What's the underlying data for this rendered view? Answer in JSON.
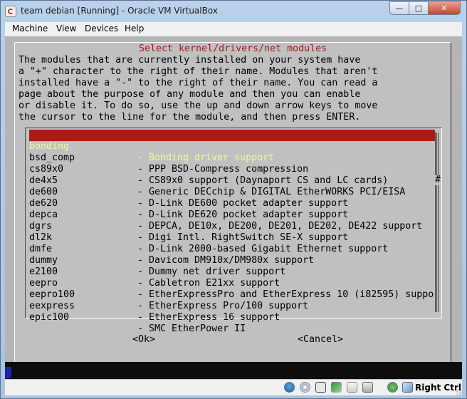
{
  "window": {
    "title": "team debian [Running] - Oracle VM VirtualBox",
    "controls": {
      "minimize": "—",
      "maximize": "□",
      "close": "✕"
    }
  },
  "menu": [
    "Machine",
    "View",
    "Devices",
    "Help"
  ],
  "dialog": {
    "title": "Select kernel/drivers/net modules",
    "description": [
      "The modules that are currently installed on your system have",
      "a \"+\" character to the right of their name. Modules that aren't",
      "installed have a \"-\" to the right of their name. You can read a",
      "page about the purpose of any module and then you can enable",
      "or disable it. To do so, use the up and down arrow keys to move",
      "the cursor to the line for the module, and then press ENTER."
    ],
    "modules": [
      {
        "name": "bonding",
        "desc": "- Bonding driver support",
        "selected": true
      },
      {
        "name": "bsd_comp",
        "desc": "- PPP BSD-Compress compression"
      },
      {
        "name": "cs89x0",
        "desc": "- CS89x0 support (Daynaport CS and LC cards)"
      },
      {
        "name": "de4x5",
        "desc": "- Generic DECchip & DIGITAL EtherWORKS PCI/EISA"
      },
      {
        "name": "de600",
        "desc": "- D-Link DE600 pocket adapter support"
      },
      {
        "name": "de620",
        "desc": "- D-Link DE620 pocket adapter support"
      },
      {
        "name": "depca",
        "desc": "- DEPCA, DE10x, DE200, DE201, DE202, DE422 support"
      },
      {
        "name": "dgrs",
        "desc": "- Digi Intl. RightSwitch SE-X support"
      },
      {
        "name": "dl2k",
        "desc": "- D-Link 2000-based Gigabit Ethernet support"
      },
      {
        "name": "dmfe",
        "desc": "- Davicom DM910x/DM980x support"
      },
      {
        "name": "dummy",
        "desc": "- Dummy net driver support"
      },
      {
        "name": "e2100",
        "desc": "- Cabletron E21xx support"
      },
      {
        "name": "eepro",
        "desc": "- EtherExpressPro and EtherExpress 10 (i82595) suppo"
      },
      {
        "name": "eepro100",
        "desc": "- EtherExpress Pro/100 support"
      },
      {
        "name": "eexpress",
        "desc": "- EtherExpress 16 support"
      },
      {
        "name": "epic100",
        "desc": "- SMC EtherPower II"
      }
    ],
    "scroll_marker": "#",
    "ok_label": "<Ok>",
    "cancel_label": "<Cancel>"
  },
  "status": {
    "host_key": "Right Ctrl",
    "icons": [
      "hard-disk-icon",
      "cd-icon",
      "usb-icon",
      "network-icon",
      "shared-folder-icon",
      "capture-icon",
      "mouse-integration-icon",
      "arrow-icon"
    ]
  },
  "colors": {
    "selected_bg": "#aa1c18",
    "selected_fg": "#f4f4a0",
    "title_red": "#a4191b",
    "screen_bg": "#b5b5b5"
  }
}
